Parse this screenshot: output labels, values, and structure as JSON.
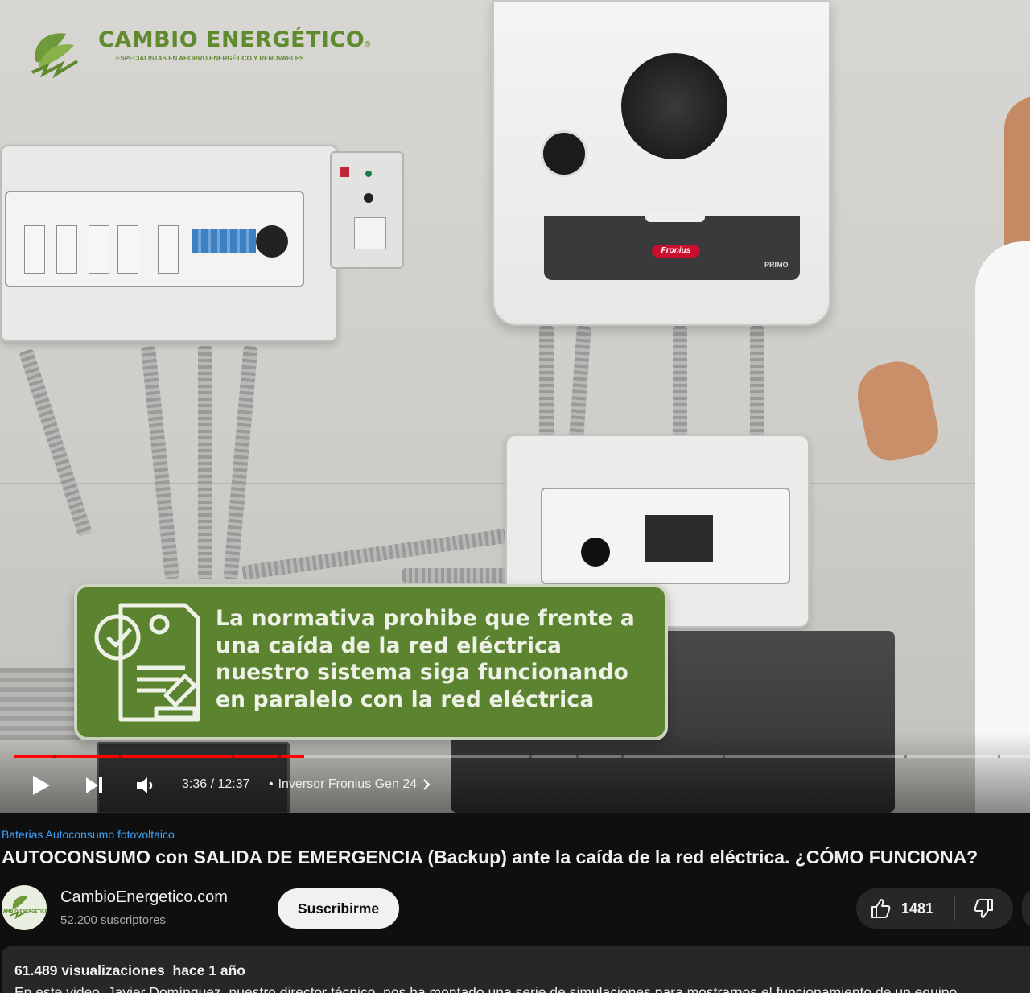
{
  "player": {
    "logo": {
      "name": "CAMBIO ENERGÉTICO",
      "registered": "®",
      "tagline": "ESPECIALISTAS EN AHORRO ENERGÉTICO Y RENOVABLES"
    },
    "inverter_brand": "Fronius",
    "inverter_model": "PRIMO",
    "callout_text": "La normativa prohibe  que frente a una caída de la red eléctrica nuestro sistema siga funcionando en paralelo con la red eléctrica",
    "progress_fraction": 0.285,
    "time_display": "3:36 / 12:37",
    "chapter_title": "Inversor Fronius Gen 24",
    "chapter_separator": "•",
    "colors": {
      "progress": "#ff0000",
      "callout_bg": "#5c8330",
      "logo_green": "#5f8a2e"
    },
    "icons": [
      "play-icon",
      "next-icon",
      "volume-icon",
      "chevron-right-icon"
    ]
  },
  "video": {
    "hashtags": "Baterias Autoconsumo fotovoltaico",
    "title": "AUTOCONSUMO con SALIDA DE EMERGENCIA (Backup) ante la caída de la red eléctrica. ¿CÓMO FUNCIONA?",
    "channel_name": "CambioEnergetico.com",
    "subscribers": "52.200 suscriptores",
    "subscribe_label": "Suscribirme",
    "likes": "1481",
    "views_and_date": "61.489 visualizaciones  hace 1 año",
    "description": "En este video, Javier Domínguez, nuestro director técnico, nos ha montado una serie de simulaciones para mostrarnos el funcionamiento de un equipo"
  },
  "avatar_text": "CAMBIO ENERGÉTICO",
  "theme": {
    "background": "#0f0f0f",
    "link": "#3ea6ff",
    "chip": "#272727"
  }
}
